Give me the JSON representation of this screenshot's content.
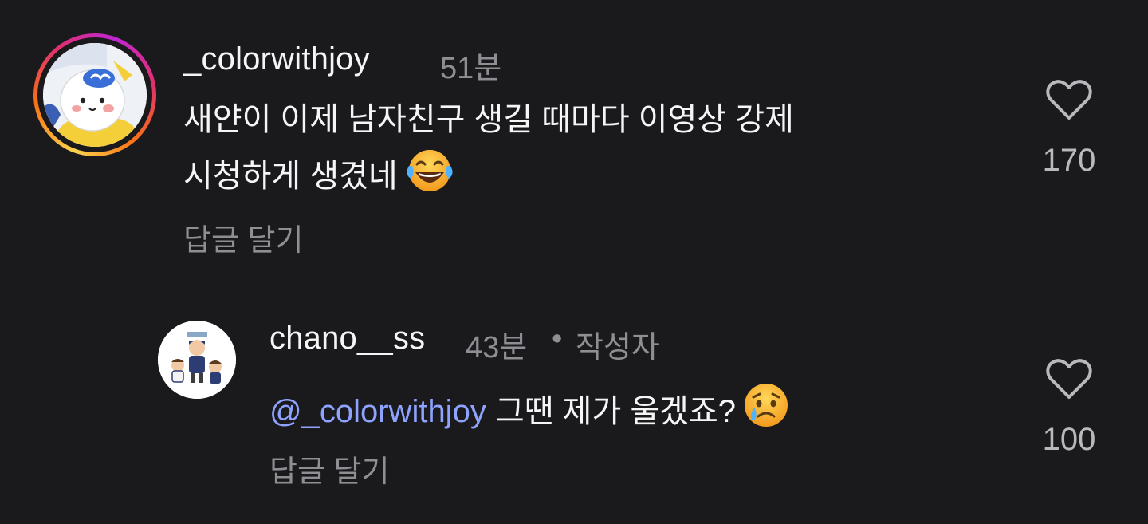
{
  "comments": [
    {
      "username": "_colorwithjoy",
      "time": "51분",
      "text_line1": "새얀이 이제 남자친구 생길 때마다 이영상 강제",
      "text_line2": "시청하게 생겼네",
      "emoji": "face-with-tears-of-joy",
      "reply_label": "답글 달기",
      "likes": "170"
    },
    {
      "username": "chano__ss",
      "time": "43분",
      "author_badge": "작성자",
      "mention": "@_colorwithjoy",
      "text": "그땐 제가 울겠죠?",
      "emoji": "crying-face",
      "reply_label": "답글 달기",
      "likes": "100"
    }
  ]
}
